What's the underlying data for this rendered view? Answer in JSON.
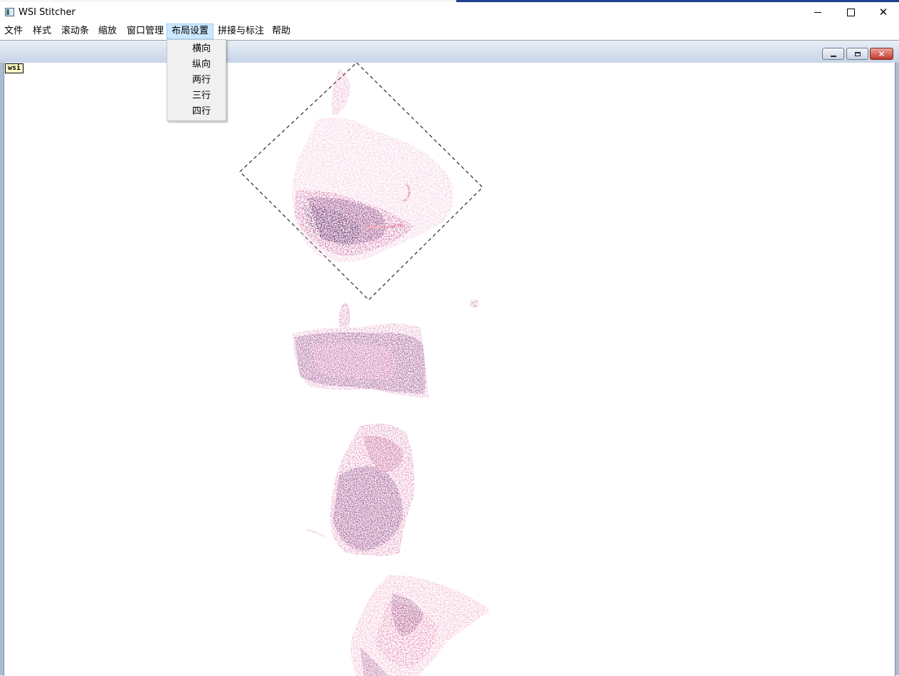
{
  "window": {
    "title": "WSI Stitcher",
    "icon": "app-icon"
  },
  "menubar": {
    "items": [
      {
        "label": "文件"
      },
      {
        "label": "样式"
      },
      {
        "label": "滚动条"
      },
      {
        "label": "缩放"
      },
      {
        "label": "窗口管理"
      },
      {
        "label": "布局设置"
      },
      {
        "label": "拼接与标注"
      },
      {
        "label": "帮助"
      }
    ],
    "open_menu": "布局设置"
  },
  "layout_menu": {
    "items": [
      {
        "label": "横向"
      },
      {
        "label": "纵向"
      },
      {
        "label": "两行"
      },
      {
        "label": "三行"
      },
      {
        "label": "四行"
      }
    ]
  },
  "subwindow": {
    "label": "wsi"
  },
  "colors": {
    "tissue_light": "#f2c6dc",
    "tissue_mid": "#d97aa8",
    "tissue_dark": "#8a2f6e",
    "nuclei": "#4a1d5a",
    "blood": "#c8203c",
    "menu_highlight": "#cce8ff"
  }
}
